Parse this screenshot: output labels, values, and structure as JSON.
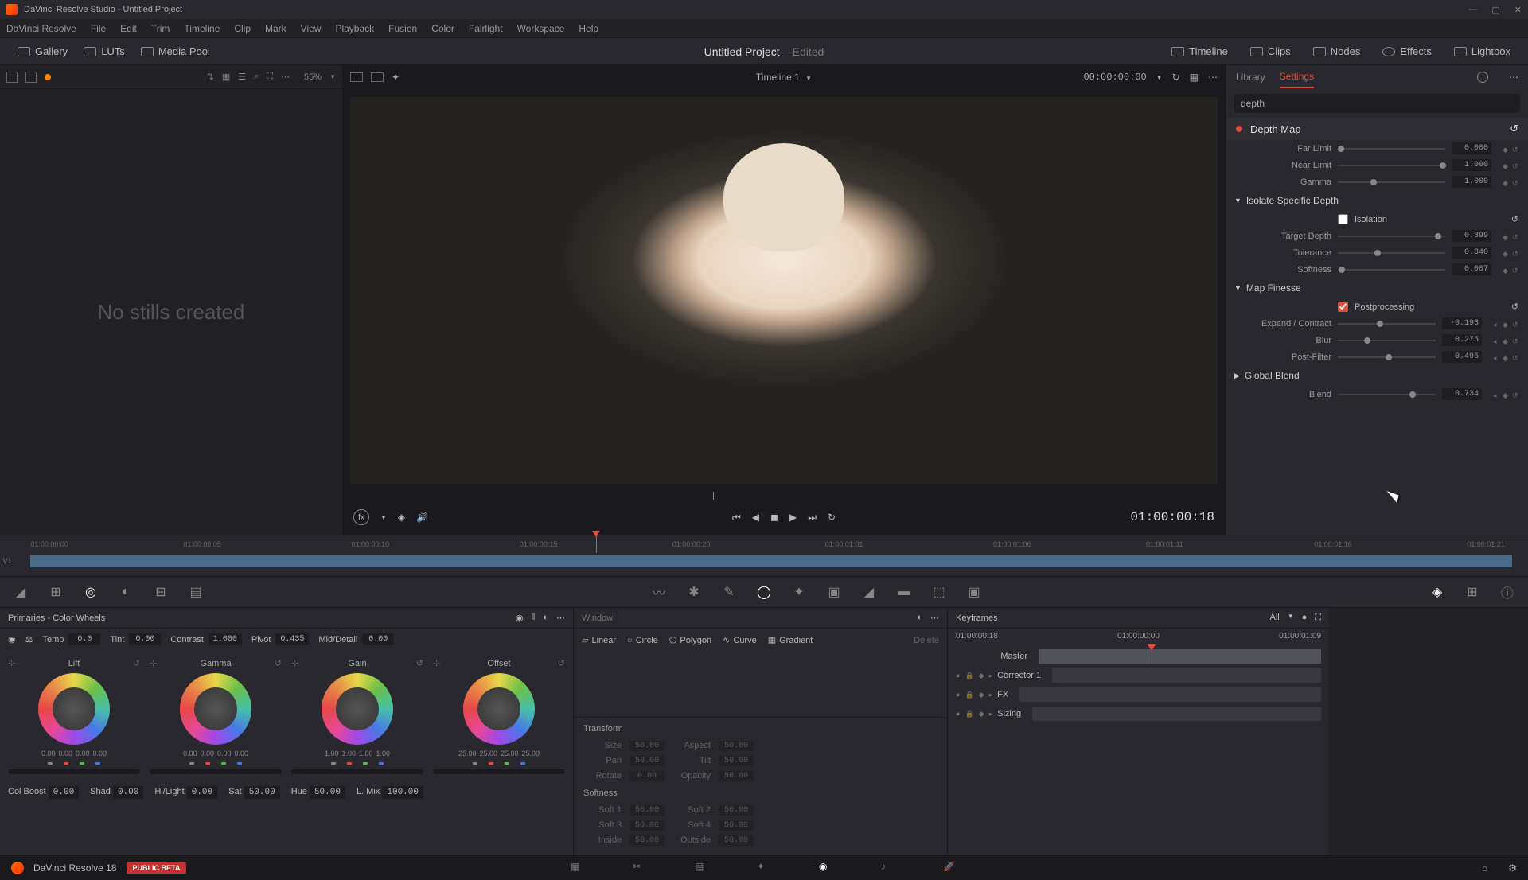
{
  "titlebar": {
    "title": "DaVinci Resolve Studio - Untitled Project"
  },
  "menubar": [
    "DaVinci Resolve",
    "File",
    "Edit",
    "Trim",
    "Timeline",
    "Clip",
    "Mark",
    "View",
    "Playback",
    "Fusion",
    "Color",
    "Fairlight",
    "Workspace",
    "Help"
  ],
  "toolbar": {
    "gallery": "Gallery",
    "luts": "LUTs",
    "mediapool": "Media Pool",
    "project": "Untitled Project",
    "status": "Edited",
    "timeline_btn": "Timeline",
    "clips": "Clips",
    "nodes": "Nodes",
    "effects": "Effects",
    "lightbox": "Lightbox"
  },
  "gallery": {
    "zoom": "55%",
    "empty": "No stills created"
  },
  "viewer": {
    "timeline_name": "Timeline 1",
    "duration": "00:00:00:00",
    "timecode": "01:00:00:18"
  },
  "settings": {
    "tab_library": "Library",
    "tab_settings": "Settings",
    "search": "depth",
    "fx_name": "Depth Map",
    "far_limit": {
      "label": "Far Limit",
      "value": "0.000"
    },
    "near_limit": {
      "label": "Near Limit",
      "value": "1.000"
    },
    "gamma": {
      "label": "Gamma",
      "value": "1.000"
    },
    "sec_isolate": "Isolate Specific Depth",
    "isolation": "Isolation",
    "target_depth": {
      "label": "Target Depth",
      "value": "0.899"
    },
    "tolerance": {
      "label": "Tolerance",
      "value": "0.340"
    },
    "softness": {
      "label": "Softness",
      "value": "0.007"
    },
    "sec_finesse": "Map Finesse",
    "postproc": "Postprocessing",
    "expand": {
      "label": "Expand / Contract",
      "value": "-0.193"
    },
    "blur": {
      "label": "Blur",
      "value": "0.275"
    },
    "postfilter": {
      "label": "Post-Filter",
      "value": "0.495"
    },
    "sec_global": "Global Blend",
    "blend": {
      "label": "Blend",
      "value": "0.734"
    }
  },
  "ruler": [
    "01:00:00:00",
    "01:00:00:05",
    "01:00:00:10",
    "01:00:00:15",
    "01:00:00:20",
    "01:00:01:01",
    "01:00:01:06",
    "01:00:01:11",
    "01:00:01:16",
    "01:00:01:21"
  ],
  "wheels": {
    "title": "Primaries - Color Wheels",
    "top": {
      "temp": {
        "l": "Temp",
        "v": "0.0"
      },
      "tint": {
        "l": "Tint",
        "v": "0.00"
      },
      "contrast": {
        "l": "Contrast",
        "v": "1.000"
      },
      "pivot": {
        "l": "Pivot",
        "v": "0.435"
      },
      "md": {
        "l": "Mid/Detail",
        "v": "0.00"
      }
    },
    "lift": {
      "name": "Lift",
      "nums": [
        "0.00",
        "0.00",
        "0.00",
        "0.00"
      ]
    },
    "gamma": {
      "name": "Gamma",
      "nums": [
        "0.00",
        "0.00",
        "0.00",
        "0.00"
      ]
    },
    "gain": {
      "name": "Gain",
      "nums": [
        "1.00",
        "1.00",
        "1.00",
        "1.00"
      ]
    },
    "offset": {
      "name": "Offset",
      "nums": [
        "25.00",
        "25.00",
        "25.00",
        "25.00"
      ]
    },
    "bottom": {
      "colboost": {
        "l": "Col Boost",
        "v": "0.00"
      },
      "shad": {
        "l": "Shad",
        "v": "0.00"
      },
      "hilight": {
        "l": "Hi/Light",
        "v": "0.00"
      },
      "sat": {
        "l": "Sat",
        "v": "50.00"
      },
      "hue": {
        "l": "Hue",
        "v": "50.00"
      },
      "lmix": {
        "l": "L. Mix",
        "v": "100.00"
      }
    }
  },
  "curves": {
    "window": "Window",
    "linear": "Linear",
    "circle": "Circle",
    "polygon": "Polygon",
    "curve": "Curve",
    "gradient": "Gradient",
    "delete": "Delete",
    "transform": "Transform",
    "size": {
      "l": "Size",
      "v": "50.00"
    },
    "aspect": {
      "l": "Aspect",
      "v": "50.00"
    },
    "pan": {
      "l": "Pan",
      "v": "50.00"
    },
    "tilt": {
      "l": "Tilt",
      "v": "50.00"
    },
    "rotate": {
      "l": "Rotate",
      "v": "0.00"
    },
    "opacity": {
      "l": "Opacity",
      "v": "50.00"
    },
    "softness": "Softness",
    "soft1": {
      "l": "Soft 1",
      "v": "50.00"
    },
    "soft2": {
      "l": "Soft 2",
      "v": "50.00"
    },
    "soft3": {
      "l": "Soft 3",
      "v": "50.00"
    },
    "soft4": {
      "l": "Soft 4",
      "v": "50.00"
    },
    "inside": {
      "l": "Inside",
      "v": "50.00"
    },
    "outside": {
      "l": "Outside",
      "v": "50.00"
    }
  },
  "keyframes": {
    "title": "Keyframes",
    "all": "All",
    "tc": "01:00:00:18",
    "ruler": [
      "01:00:00:00",
      "01:00:01:09"
    ],
    "master": "Master",
    "corrector": "Corrector 1",
    "fx": "FX",
    "sizing": "Sizing"
  },
  "footer": {
    "app": "DaVinci Resolve 18",
    "badge": "PUBLIC BETA"
  }
}
